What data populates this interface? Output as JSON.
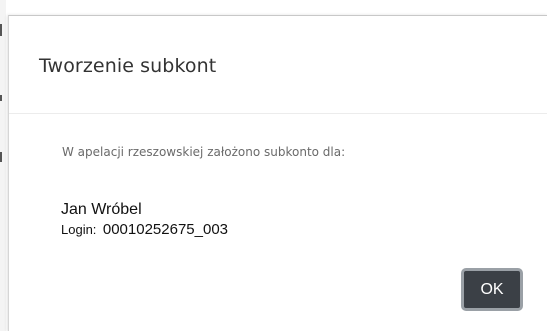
{
  "dialog": {
    "title": "Tworzenie subkont",
    "message": "W apelacji rzeszowskiej założono subkonto dla:",
    "person_name": "Jan Wróbel",
    "login_label": "Login:",
    "login_value": "00010252675_003",
    "ok_label": "OK"
  },
  "colors": {
    "button_background": "#3b4046",
    "button_focus_ring": "#9aa0a6",
    "title_text": "#333333",
    "message_text": "#6a6a6a"
  }
}
